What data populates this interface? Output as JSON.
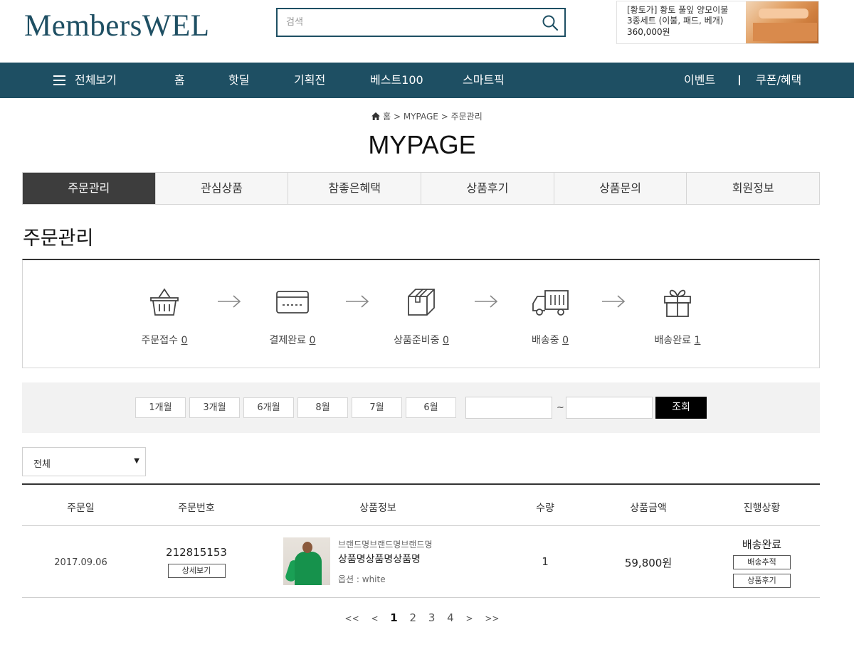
{
  "header": {
    "logo": "MembersWEL",
    "search_placeholder": "검색",
    "ad": {
      "line1": "[황토가] 황토 풀잎 양모이불",
      "line2": "3종세트 (이불, 패드, 베개)",
      "price": "360,000원"
    }
  },
  "nav": {
    "all_menu": "전체보기",
    "items": [
      "홈",
      "핫딜",
      "기획전",
      "베스트100",
      "스마트픽"
    ],
    "events": "이벤트",
    "coupons": "쿠폰/혜택"
  },
  "breadcrumb": {
    "home": "홈",
    "mypage": "MYPAGE",
    "current": "주문관리",
    "sep": ">"
  },
  "page_title": "MYPAGE",
  "tabs": [
    "주문관리",
    "관심상품",
    "참좋은혜택",
    "상품후기",
    "상품문의",
    "회원정보"
  ],
  "active_tab": "주문관리",
  "section_title": "주문관리",
  "order_steps": [
    {
      "label": "주문접수",
      "count": "0",
      "icon": "basket-icon"
    },
    {
      "label": "결제완료",
      "count": "0",
      "icon": "credit-card-icon"
    },
    {
      "label": "상품준비중",
      "count": "0",
      "icon": "box-icon"
    },
    {
      "label": "배송중",
      "count": "0",
      "icon": "truck-icon"
    },
    {
      "label": "배송완료",
      "count": "1",
      "icon": "gift-icon"
    }
  ],
  "filter": {
    "periods": [
      "1개월",
      "3개월",
      "6개월",
      "8월",
      "7월",
      "6월"
    ],
    "tilde": "~",
    "search_button": "조회"
  },
  "status_select": {
    "value": "전체"
  },
  "table": {
    "headers": [
      "주문일",
      "주문번호",
      "상품정보",
      "수량",
      "상품금액",
      "진행상황"
    ],
    "rows": [
      {
        "date": "2017.09.06",
        "order_no": "212815153",
        "detail_button": "상세보기",
        "brand": "브랜드명브랜드명브랜드명",
        "product": "상품명상품명상품명",
        "option": "옵션 : white",
        "qty": "1",
        "price": "59,800원",
        "status": "배송완료",
        "track_button": "배송추적",
        "review_button": "상품후기"
      }
    ]
  },
  "pagination": {
    "first": "<<",
    "prev": "<",
    "pages": [
      "1",
      "2",
      "3",
      "4"
    ],
    "current": "1",
    "next": ">",
    "last": ">>"
  },
  "colors": {
    "brand": "#1e4f63",
    "active_tab": "#3d3d3d",
    "filter_bg": "#f2f2f2"
  }
}
